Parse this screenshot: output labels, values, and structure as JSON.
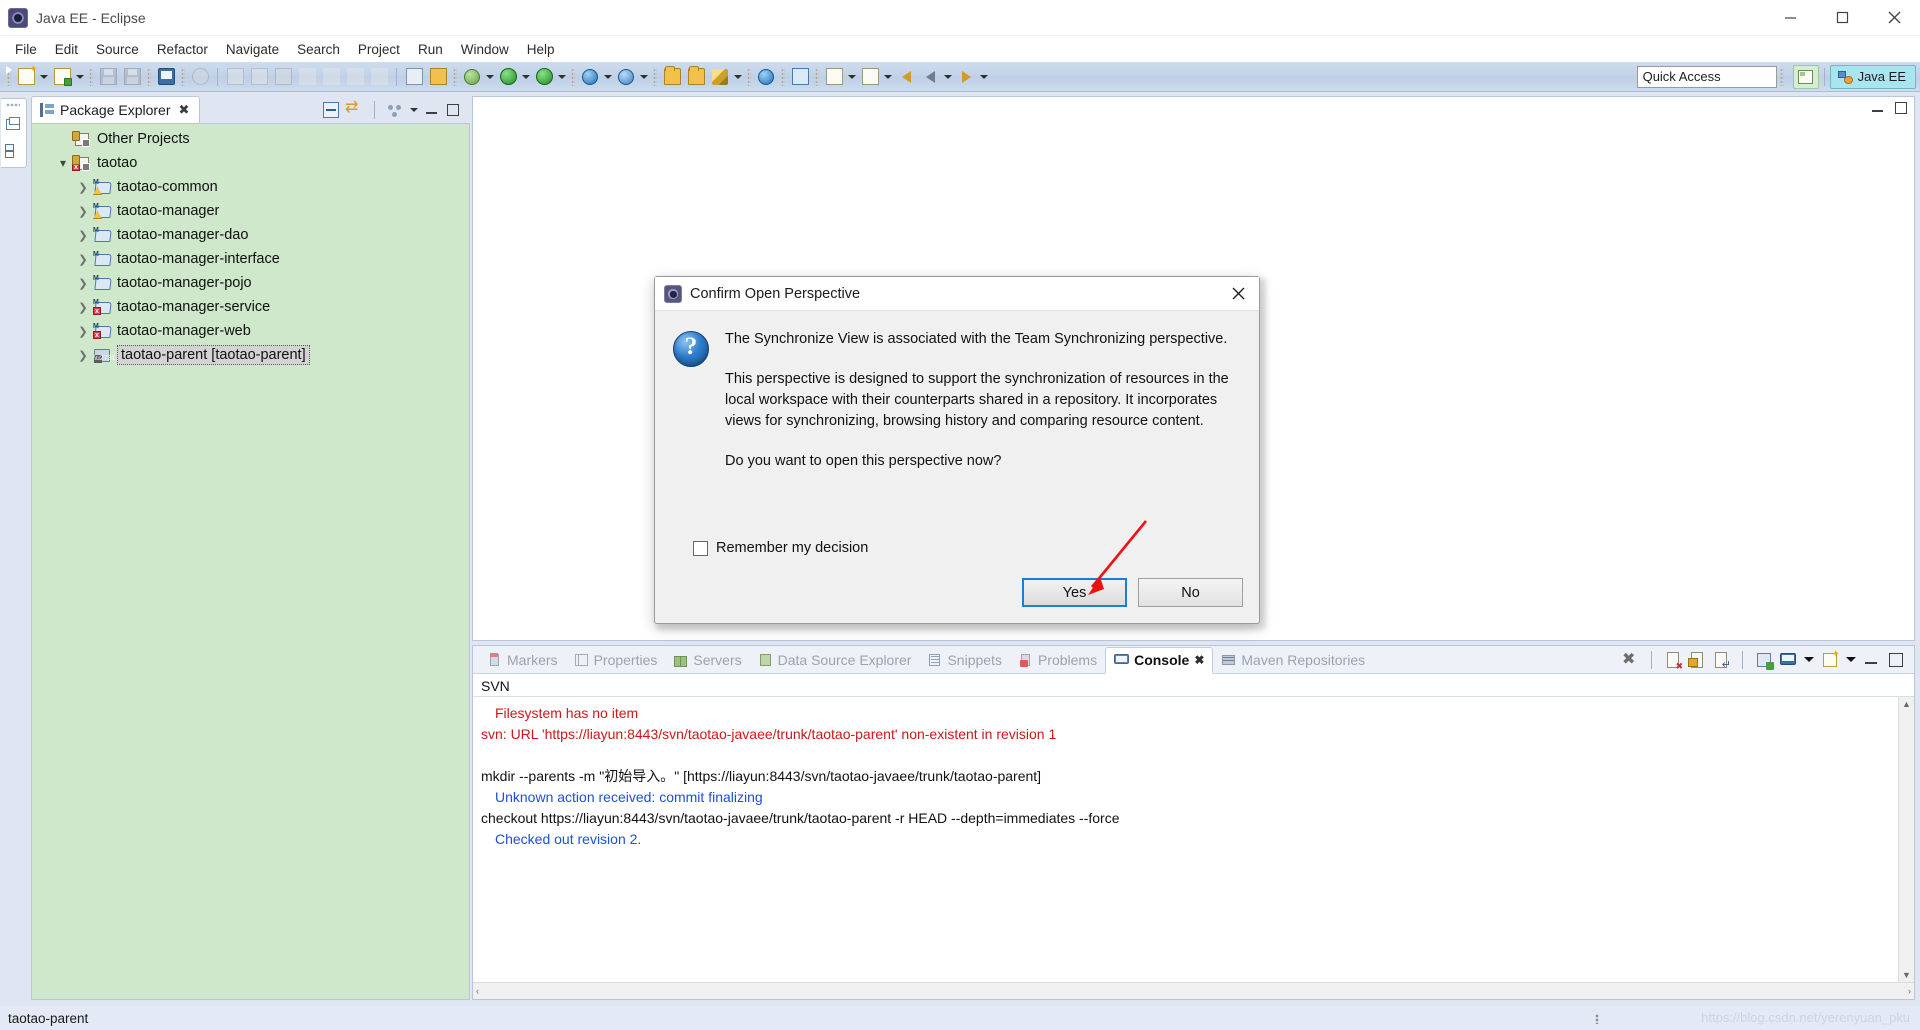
{
  "window": {
    "title": "Java EE - Eclipse",
    "app_icon": "eclipse-icon",
    "controls": {
      "minimize": "─",
      "maximize": "□",
      "close": "✕"
    }
  },
  "menubar": {
    "items": [
      "File",
      "Edit",
      "Source",
      "Refactor",
      "Navigate",
      "Search",
      "Project",
      "Run",
      "Window",
      "Help"
    ]
  },
  "toolbar": {
    "quick_access": "Quick Access",
    "perspective_open_label": "open-perspective-icon",
    "perspective_tab": "Java EE",
    "groups": [
      {
        "icons": [
          "new-wizard-icon",
          "dropdown-arrow",
          "new-file-icon",
          "dropdown-arrow"
        ]
      },
      {
        "icons": [
          "save-icon",
          "save-all-icon"
        ]
      },
      {
        "icons": [
          "console-display-icon"
        ]
      },
      {
        "icons": [
          "skip-breakpoints-icon"
        ]
      },
      {
        "icons": [
          "resume-icon",
          "suspend-icon",
          "terminate-icon",
          "disconnect-icon",
          "step-into-icon",
          "step-over-icon",
          "step-return-icon"
        ]
      },
      {
        "icons": [
          "run-last-tool-icon",
          "external-tools-icon"
        ]
      },
      {
        "icons": [
          "debug-icon",
          "dropdown-arrow",
          "run-icon",
          "dropdown-arrow"
        ]
      },
      {
        "icons": [
          "run-server-icon",
          "dropdown-arrow"
        ]
      },
      {
        "icons": [
          "new-web-project-icon",
          "dropdown-arrow",
          "new-server-icon",
          "dropdown-arrow"
        ]
      },
      {
        "icons": [
          "open-type-icon",
          "open-resource-icon",
          "search-icon",
          "dropdown-arrow"
        ]
      },
      {
        "icons": [
          "open-web-browser-icon"
        ]
      },
      {
        "icons": [
          "run-on-server-icon"
        ]
      },
      {
        "icons": [
          "next-annotation-icon",
          "dropdown-arrow",
          "previous-annotation-icon",
          "dropdown-arrow"
        ]
      },
      {
        "icons": [
          "back-icon",
          "back-history-icon",
          "dropdown-arrow",
          "forward-icon",
          "dropdown-arrow"
        ]
      }
    ]
  },
  "left_rail": {
    "items": [
      "restore-icon",
      "package-explorer-icon"
    ]
  },
  "package_explorer": {
    "tab_label": "Package Explorer",
    "tab_close": "✖",
    "toolbar_icons": [
      "collapse-all-icon",
      "link-with-editor-icon",
      "view-menu-icon",
      "view-menu-arrow",
      "minimize-icon",
      "maximize-icon"
    ],
    "tree": [
      {
        "label": "Other Projects",
        "indent": 0,
        "twisty": "none",
        "icon": "project-closed-icon",
        "selected": false,
        "error": false
      },
      {
        "label": "taotao",
        "indent": 0,
        "twisty": "open",
        "icon": "project-open-icon",
        "selected": false,
        "error": true
      },
      {
        "label": "taotao-common",
        "indent": 1,
        "twisty": "closed",
        "icon": "maven-project-icon",
        "selected": false,
        "warn": true
      },
      {
        "label": "taotao-manager",
        "indent": 1,
        "twisty": "closed",
        "icon": "maven-project-icon",
        "selected": false,
        "warn": true
      },
      {
        "label": "taotao-manager-dao",
        "indent": 1,
        "twisty": "closed",
        "icon": "maven-project-icon",
        "selected": false
      },
      {
        "label": "taotao-manager-interface",
        "indent": 1,
        "twisty": "closed",
        "icon": "maven-project-icon",
        "selected": false
      },
      {
        "label": "taotao-manager-pojo",
        "indent": 1,
        "twisty": "closed",
        "icon": "maven-project-icon",
        "selected": false
      },
      {
        "label": "taotao-manager-service",
        "indent": 1,
        "twisty": "closed",
        "icon": "maven-project-icon",
        "selected": false,
        "error": true
      },
      {
        "label": "taotao-manager-web",
        "indent": 1,
        "twisty": "closed",
        "icon": "maven-project-icon",
        "selected": false,
        "error": true
      },
      {
        "label": "taotao-parent [taotao-parent]",
        "indent": 1,
        "twisty": "closed",
        "icon": "shared-project-icon",
        "selected": true
      }
    ]
  },
  "editor_area": {
    "corner_icons": [
      "minimize-icon",
      "maximize-icon"
    ]
  },
  "bottom_panel": {
    "tabs": [
      {
        "label": "Markers",
        "icon": "markers-icon",
        "active": false
      },
      {
        "label": "Properties",
        "icon": "properties-icon",
        "active": false
      },
      {
        "label": "Servers",
        "icon": "servers-icon",
        "active": false
      },
      {
        "label": "Data Source Explorer",
        "icon": "data-source-icon",
        "active": false
      },
      {
        "label": "Snippets",
        "icon": "snippets-icon",
        "active": false
      },
      {
        "label": "Problems",
        "icon": "problems-icon",
        "active": false
      },
      {
        "label": "Console",
        "icon": "console-icon",
        "active": true,
        "close": "✖"
      },
      {
        "label": "Maven Repositories",
        "icon": "maven-repositories-icon",
        "active": false
      }
    ],
    "toolbar_icons": [
      "terminate-icon",
      "remove-launch-icon",
      "pin-console-icon",
      "scroll-lock-icon",
      "new-console-view-icon",
      "display-selected-console-icon",
      "console-menu-arrow",
      "open-console-icon",
      "open-console-arrow",
      "minimize-icon",
      "maximize-icon"
    ],
    "console_title": "SVN",
    "console_lines": [
      {
        "text": "Filesystem has no item",
        "color": "err",
        "indent": true
      },
      {
        "text": "svn: URL 'https://liayun:8443/svn/taotao-javaee/trunk/taotao-parent' non-existent in revision 1",
        "color": "err",
        "indent": false
      },
      {
        "text": "",
        "color": "blank",
        "indent": false
      },
      {
        "text": "mkdir --parents -m \"初始导入。\" [https://liayun:8443/svn/taotao-javaee/trunk/taotao-parent]",
        "color": "black",
        "indent": false
      },
      {
        "text": "Unknown action received: commit finalizing",
        "color": "blue",
        "indent": true
      },
      {
        "text": "checkout https://liayun:8443/svn/taotao-javaee/trunk/taotao-parent -r HEAD --depth=immediates --force",
        "color": "black",
        "indent": false
      },
      {
        "text": "Checked out revision 2.",
        "color": "blue",
        "indent": true
      }
    ],
    "scroll_up": "▲",
    "scroll_down": "▼",
    "scroll_left": "‹",
    "scroll_right": "›"
  },
  "statusbar": {
    "text": "taotao-parent",
    "watermark": "https://blog.csdn.net/yerenyuan_pku"
  },
  "dialog": {
    "title": "Confirm Open Perspective",
    "icon": "question-icon",
    "close": "✕",
    "paragraphs": [
      "The Synchronize View is associated with the Team Synchronizing perspective.",
      "This perspective is designed to support the synchronization of resources in the local workspace with their counterparts shared in a repository. It incorporates views for synchronizing, browsing history and comparing resource content.",
      "Do you want to open this perspective now?"
    ],
    "checkbox_label": "Remember my decision",
    "checkbox_checked": false,
    "yes_label": "Yes",
    "no_label": "No",
    "default_button": "Yes"
  },
  "annotation": {
    "arrow_color": "#ee1111"
  },
  "colors": {
    "tree_background": "#cfe8cb",
    "chrome": "#dfe6f2",
    "toolbar": "#c5d4e9",
    "error_text": "#cf1717",
    "info_text": "#1e4fd6",
    "accent": "#1a7fd4"
  }
}
